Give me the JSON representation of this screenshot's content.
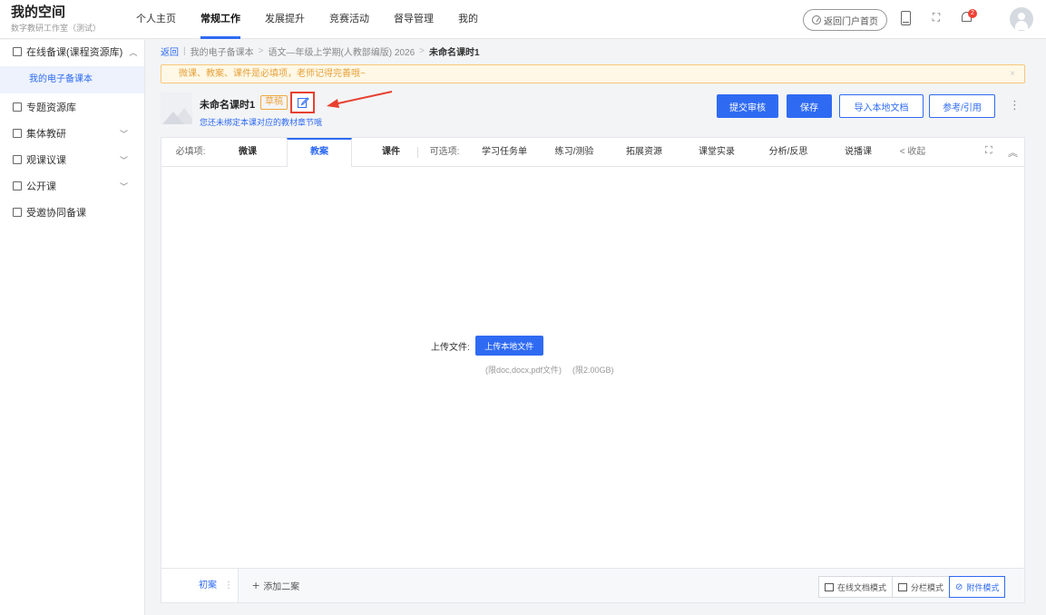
{
  "header": {
    "title": "我的空间",
    "subtitle": "数字教研工作室（测试）",
    "nav": [
      "个人主页",
      "常规工作",
      "发展提升",
      "竞赛活动",
      "督导管理",
      "我的"
    ],
    "active_nav": "常规工作",
    "portal_button": "返回门户首页",
    "notification_count": "2"
  },
  "sidebar": {
    "items": [
      {
        "label": "在线备课(课程资源库)",
        "expanded": true,
        "icon": "document-icon"
      },
      {
        "label": "专题资源库",
        "icon": "folder-icon"
      },
      {
        "label": "集体教研",
        "icon": "book-icon"
      },
      {
        "label": "观课议课",
        "icon": "classroom-icon"
      },
      {
        "label": "公开课",
        "icon": "screen-icon"
      },
      {
        "label": "受邀协同备课",
        "icon": "people-icon"
      }
    ],
    "sub_item": "我的电子备课本"
  },
  "breadcrumb": {
    "back": "返回",
    "items": [
      "我的电子备课本",
      "语文—年级上学期(人教部编版) 2026"
    ],
    "current": "未命名课时1"
  },
  "notice": {
    "text": "微课、教案、课件是必填项，老师记得完善哦~",
    "close": "×"
  },
  "lesson": {
    "title": "未命名课时1",
    "status": "草稿",
    "hint": "您还未绑定本课对应的教材章节哦"
  },
  "actions": {
    "submit": "提交审核",
    "save": "保存",
    "import": "导入本地文档",
    "reference": "参考/引用",
    "more": "⋮"
  },
  "tabs": {
    "required_label": "必填项:",
    "required": [
      "微课",
      "教案",
      "课件"
    ],
    "active": "教案",
    "optional_label": "可选项:",
    "optional": [
      "学习任务单",
      "练习/测验",
      "拓展资源",
      "课堂实录",
      "分析/反思",
      "说播课"
    ],
    "collapse": "< 收起"
  },
  "upload": {
    "label": "上传文件:",
    "button": "上传本地文件",
    "limit_types": "(限doc,docx,pdf文件)",
    "limit_size": "(限2.00GB)"
  },
  "footer": {
    "draft_tab": "初案",
    "draft_colon": "⋮",
    "add_plan": "添加二案",
    "modes": [
      "在线文档模式",
      "分栏模式",
      "附件模式"
    ],
    "active_mode": "附件模式"
  },
  "colors": {
    "accent": "#2f6bf2",
    "warning": "#f0a640",
    "highlight": "#e8402f"
  }
}
